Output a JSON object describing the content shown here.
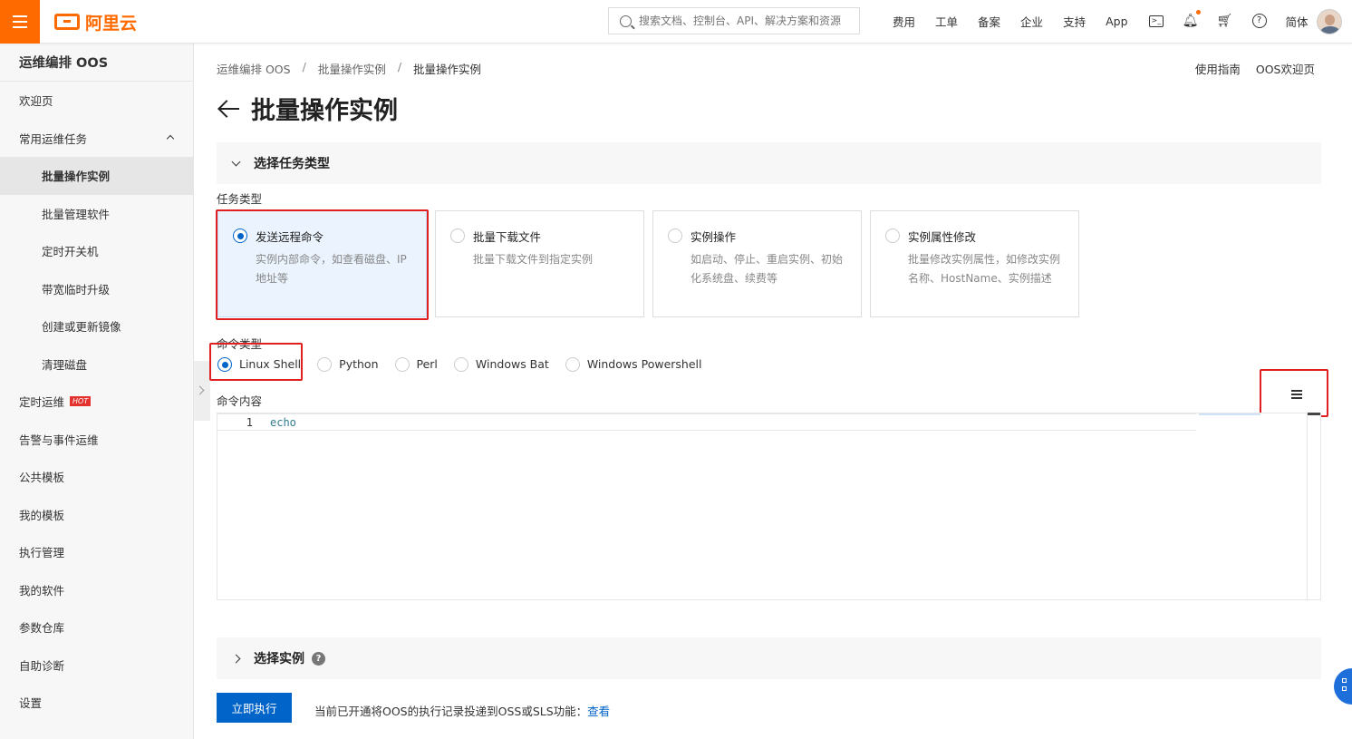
{
  "header": {
    "logo_text": "阿里云",
    "search_placeholder": "搜索文档、控制台、API、解决方案和资源",
    "links": [
      "费用",
      "工单",
      "备案",
      "企业",
      "支持",
      "App"
    ],
    "lang": "简体",
    "accent_color": "#ff6a00"
  },
  "sidebar": {
    "title": "运维编排 OOS",
    "items": [
      {
        "label": "欢迎页"
      },
      {
        "label": "常用运维任务"
      },
      {
        "label": "批量操作实例"
      },
      {
        "label": "批量管理软件"
      },
      {
        "label": "定时开关机"
      },
      {
        "label": "带宽临时升级"
      },
      {
        "label": "创建或更新镜像"
      },
      {
        "label": "清理磁盘"
      },
      {
        "label": "定时运维",
        "badge": "HOT"
      },
      {
        "label": "告警与事件运维"
      },
      {
        "label": "公共模板"
      },
      {
        "label": "我的模板"
      },
      {
        "label": "执行管理"
      },
      {
        "label": "我的软件"
      },
      {
        "label": "参数仓库"
      },
      {
        "label": "自助诊断"
      },
      {
        "label": "设置"
      }
    ]
  },
  "breadcrumb": [
    "运维编排 OOS",
    "批量操作实例",
    "批量操作实例"
  ],
  "top_right_links": [
    "使用指南",
    "OOS欢迎页"
  ],
  "page_title": "批量操作实例",
  "section_task_type": {
    "title": "选择任务类型",
    "field_label": "任务类型",
    "cards": [
      {
        "title": "发送远程命令",
        "desc": "实例内部命令，如查看磁盘、IP地址等",
        "selected": true
      },
      {
        "title": "批量下载文件",
        "desc": "批量下载文件到指定实例",
        "selected": false
      },
      {
        "title": "实例操作",
        "desc": "如启动、停止、重启实例、初始化系统盘、续费等",
        "selected": false
      },
      {
        "title": "实例属性修改",
        "desc": "批量修改实例属性，如修改实例名称、HostName、实例描述",
        "selected": false
      }
    ]
  },
  "command_type": {
    "label": "命令类型",
    "options": [
      "Linux Shell",
      "Python",
      "Perl",
      "Windows Bat",
      "Windows Powershell"
    ],
    "selected": "Linux Shell"
  },
  "command_content": {
    "label": "命令内容",
    "line_number": "1",
    "code": "echo"
  },
  "section_instances": {
    "title": "选择实例",
    "help": "?"
  },
  "footer": {
    "run_button": "立即执行",
    "note": "当前已开通将OOS的执行记录投递到OSS或SLS功能：",
    "note_link": "查看"
  },
  "colors": {
    "primary": "#0064c8",
    "highlight": "#e02020"
  }
}
